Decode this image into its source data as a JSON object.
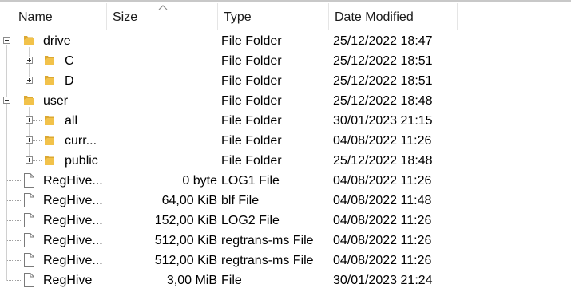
{
  "columns": {
    "name": "Name",
    "size": "Size",
    "type": "Type",
    "date": "Date Modified"
  },
  "rows": [
    {
      "name": "drive",
      "size": "",
      "type": "File Folder",
      "date": "25/12/2022 18:47",
      "icon": "folder-icon",
      "level": 0,
      "expander": "minus"
    },
    {
      "name": "C",
      "size": "",
      "type": "File Folder",
      "date": "25/12/2022 18:51",
      "icon": "folder-icon",
      "level": 1,
      "expander": "plus"
    },
    {
      "name": "D",
      "size": "",
      "type": "File Folder",
      "date": "25/12/2022 18:51",
      "icon": "folder-icon",
      "level": 1,
      "expander": "plus"
    },
    {
      "name": "user",
      "size": "",
      "type": "File Folder",
      "date": "25/12/2022 18:48",
      "icon": "folder-icon",
      "level": 0,
      "expander": "minus"
    },
    {
      "name": "all",
      "size": "",
      "type": "File Folder",
      "date": "30/01/2023 21:15",
      "icon": "folder-icon",
      "level": 1,
      "expander": "plus"
    },
    {
      "name": "curr...",
      "size": "",
      "type": "File Folder",
      "date": "04/08/2022 11:26",
      "icon": "folder-icon",
      "level": 1,
      "expander": "plus"
    },
    {
      "name": "public",
      "size": "",
      "type": "File Folder",
      "date": "25/12/2022 18:48",
      "icon": "folder-icon",
      "level": 1,
      "expander": "plus"
    },
    {
      "name": "RegHive...",
      "size": "0 byte",
      "type": "LOG1 File",
      "date": "04/08/2022 11:26",
      "icon": "file-icon",
      "level": 0,
      "expander": "none"
    },
    {
      "name": "RegHive...",
      "size": "64,00 KiB",
      "type": "blf File",
      "date": "04/08/2022 11:48",
      "icon": "file-icon",
      "level": 0,
      "expander": "none"
    },
    {
      "name": "RegHive...",
      "size": "152,00 KiB",
      "type": "LOG2 File",
      "date": "04/08/2022 11:26",
      "icon": "file-icon",
      "level": 0,
      "expander": "none"
    },
    {
      "name": "RegHive...",
      "size": "512,00 KiB",
      "type": "regtrans-ms File",
      "date": "04/08/2022 11:26",
      "icon": "file-icon",
      "level": 0,
      "expander": "none"
    },
    {
      "name": "RegHive...",
      "size": "512,00 KiB",
      "type": "regtrans-ms File",
      "date": "04/08/2022 11:26",
      "icon": "file-icon",
      "level": 0,
      "expander": "none"
    },
    {
      "name": "RegHive",
      "size": "3,00 MiB",
      "type": "File",
      "date": "30/01/2023 21:24",
      "icon": "file-icon",
      "level": 0,
      "expander": "none"
    }
  ],
  "colors": {
    "folder": "#f2c24a",
    "folder_dark": "#dca832",
    "tree_line": "#a0a0a0",
    "header_sep": "#e5e5e5"
  }
}
